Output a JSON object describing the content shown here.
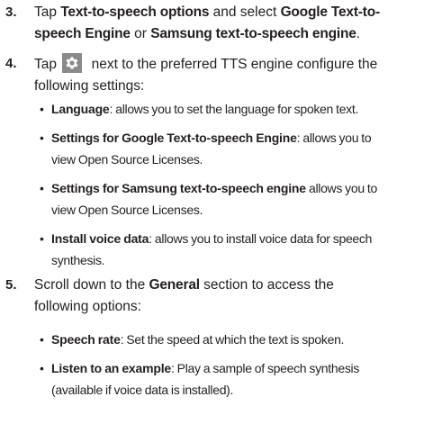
{
  "steps": [
    {
      "number": "3.",
      "line1_pre": "Tap ",
      "line1_bold1": "Text-to-speech options",
      "line1_mid": " and select ",
      "line1_bold2": "Google Text-to-",
      "line2_bold": "speech Engine",
      "line2_mid": " or ",
      "line2_bold2": "Samsung text-to-speech engine",
      "line2_post": "."
    },
    {
      "number": "4.",
      "line1_pre": "Tap ",
      "icon": "gear-icon",
      "line1_post": " next to the preferred TTS engine configure the",
      "line2": "following settings:",
      "bullets": [
        {
          "label": "Language",
          "line1": ": allows you to set the language for spoken text.",
          "line2": ""
        },
        {
          "label": "Settings for Google Text-to-speech Engine",
          "line1": ": allows you to",
          "line2": "view Open Source Licenses."
        },
        {
          "label": "Settings for Samsung text-to-speech engine",
          "line1": " allows you to",
          "line2": "view Open Source Licenses."
        },
        {
          "label": "Install voice data",
          "line1": ": allows you to install voice data for speech",
          "line2": "synthesis."
        }
      ]
    },
    {
      "number": "5.",
      "line1_pre": "Scroll down to the ",
      "line1_bold": "General",
      "line1_post": " section to access the",
      "line2": "following options:",
      "bullets": [
        {
          "label": "Speech rate",
          "line1": ": Set the speed at which the text is spoken.",
          "line2": ""
        },
        {
          "label": "Listen to an example",
          "line1": ": Play a sample of speech synthesis",
          "line2": "(available if voice data is installed)."
        }
      ]
    }
  ],
  "colors": {
    "text": "#231f20",
    "icon_bg": "#8a8a8a",
    "icon_fg": "#ffffff"
  }
}
